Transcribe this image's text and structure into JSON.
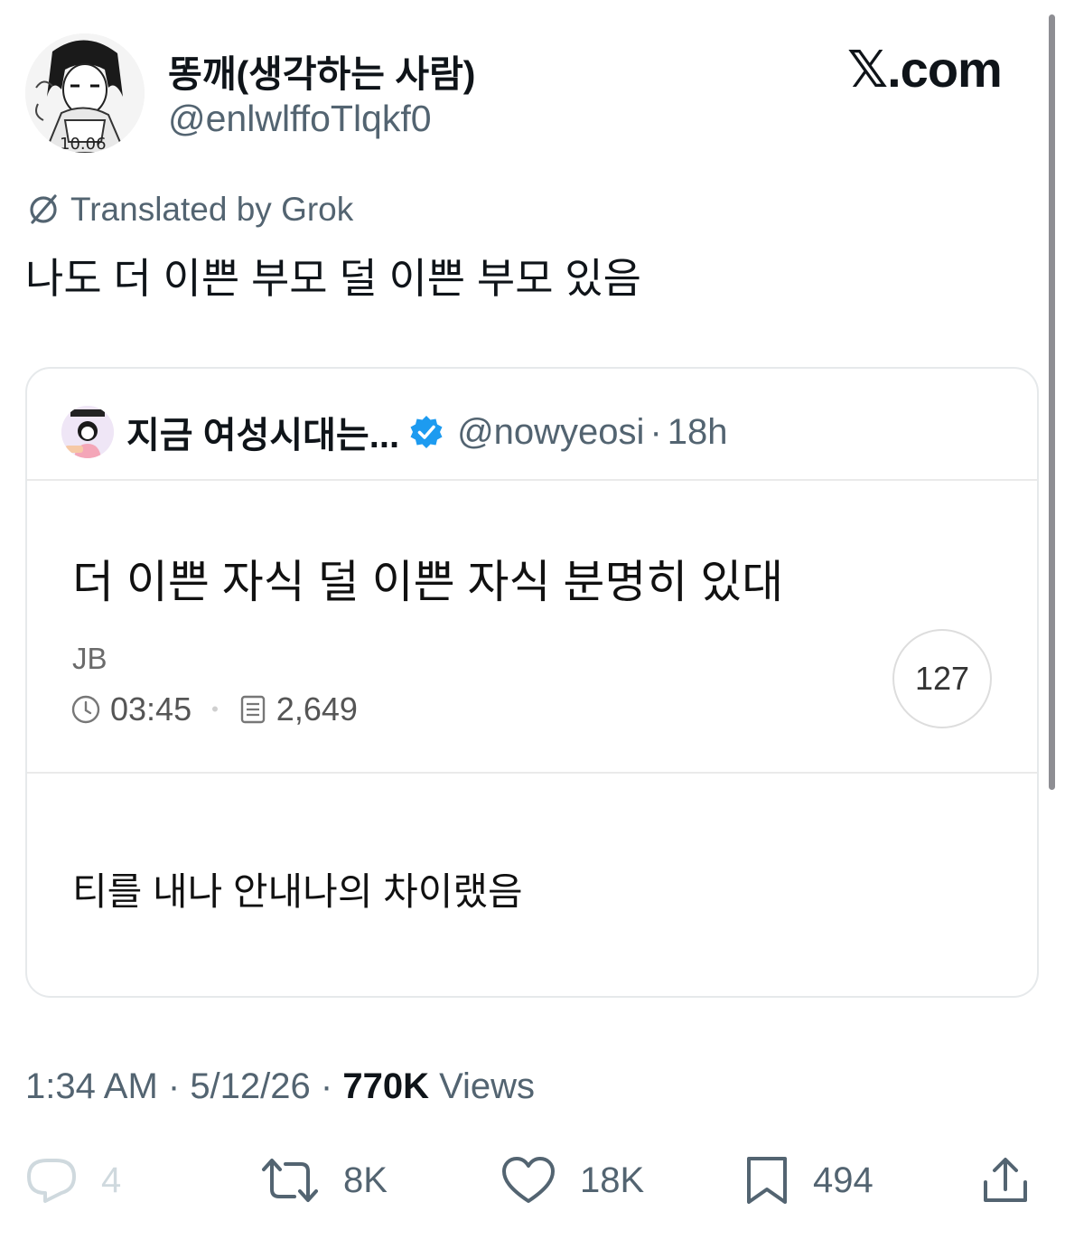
{
  "author": {
    "display_name": "똥깨(생각하는 사람)",
    "handle": "@enlwlffoTlqkf0"
  },
  "brand": "𝕏.com",
  "translation": {
    "label": "Translated by Grok"
  },
  "tweet": {
    "text": "나도 더 이쁜 부모 덜 이쁜 부모 있음"
  },
  "quoted": {
    "display_name": "지금 여성시대는...",
    "handle": "@nowyeosi",
    "separator": "·",
    "time_ago": "18h",
    "post": {
      "title": "더 이쁜 자식 덜 이쁜 자식 분명히 있대",
      "author": "JB",
      "time": "03:45",
      "views": "2,649",
      "comments": "127",
      "body": "티를 내나 안내나의 차이랬음"
    }
  },
  "meta": {
    "time": "1:34 AM",
    "sep1": " · ",
    "date": "5/12/26",
    "sep2": " · ",
    "views_count": "770K",
    "views_label": " Views"
  },
  "actions": {
    "replies": "4",
    "reposts": "8K",
    "likes": "18K",
    "bookmarks": "494"
  },
  "colors": {
    "text_primary": "#0f1419",
    "text_secondary": "#536471",
    "verified_blue": "#1d9bf0",
    "border": "#e6e9eb"
  },
  "icons": [
    "translate-icon",
    "verified-badge-icon",
    "clock-icon",
    "document-icon",
    "reply-icon",
    "repost-icon",
    "like-icon",
    "bookmark-icon",
    "share-icon"
  ]
}
